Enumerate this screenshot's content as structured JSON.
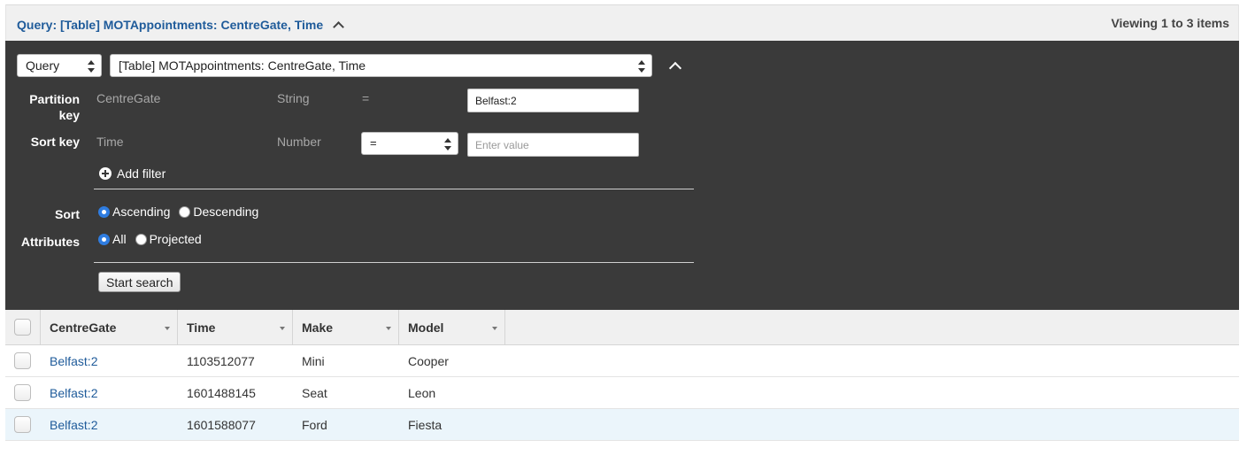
{
  "header": {
    "title": "Query: [Table] MOTAppointments: CentreGate, Time",
    "count": "Viewing 1 to 3 items"
  },
  "query_panel": {
    "mode_select": "Query",
    "index_select": "[Table] MOTAppointments: CentreGate, Time",
    "partition_key": {
      "label": "Partition key",
      "name": "CentreGate",
      "type": "String",
      "operator": "=",
      "value": "Belfast:2"
    },
    "sort_key": {
      "label": "Sort key",
      "name": "Time",
      "type": "Number",
      "operator": "=",
      "placeholder": "Enter value"
    },
    "add_filter": "Add filter",
    "sort": {
      "label": "Sort",
      "options": [
        "Ascending",
        "Descending"
      ],
      "selected": "Ascending"
    },
    "attributes": {
      "label": "Attributes",
      "options": [
        "All",
        "Projected"
      ],
      "selected": "All"
    },
    "start_button": "Start search"
  },
  "table": {
    "columns": [
      "CentreGate",
      "Time",
      "Make",
      "Model"
    ],
    "rows": [
      [
        "Belfast:2",
        "1103512077",
        "Mini",
        "Cooper"
      ],
      [
        "Belfast:2",
        "1601488145",
        "Seat",
        "Leon"
      ],
      [
        "Belfast:2",
        "1601588077",
        "Ford",
        "Fiesta"
      ]
    ]
  },
  "colors": {
    "link": "#1f5b9a",
    "panel_bg": "#3a3a3a",
    "radio_on": "#2f7de1",
    "row_highlight": "#ebf5fb"
  }
}
